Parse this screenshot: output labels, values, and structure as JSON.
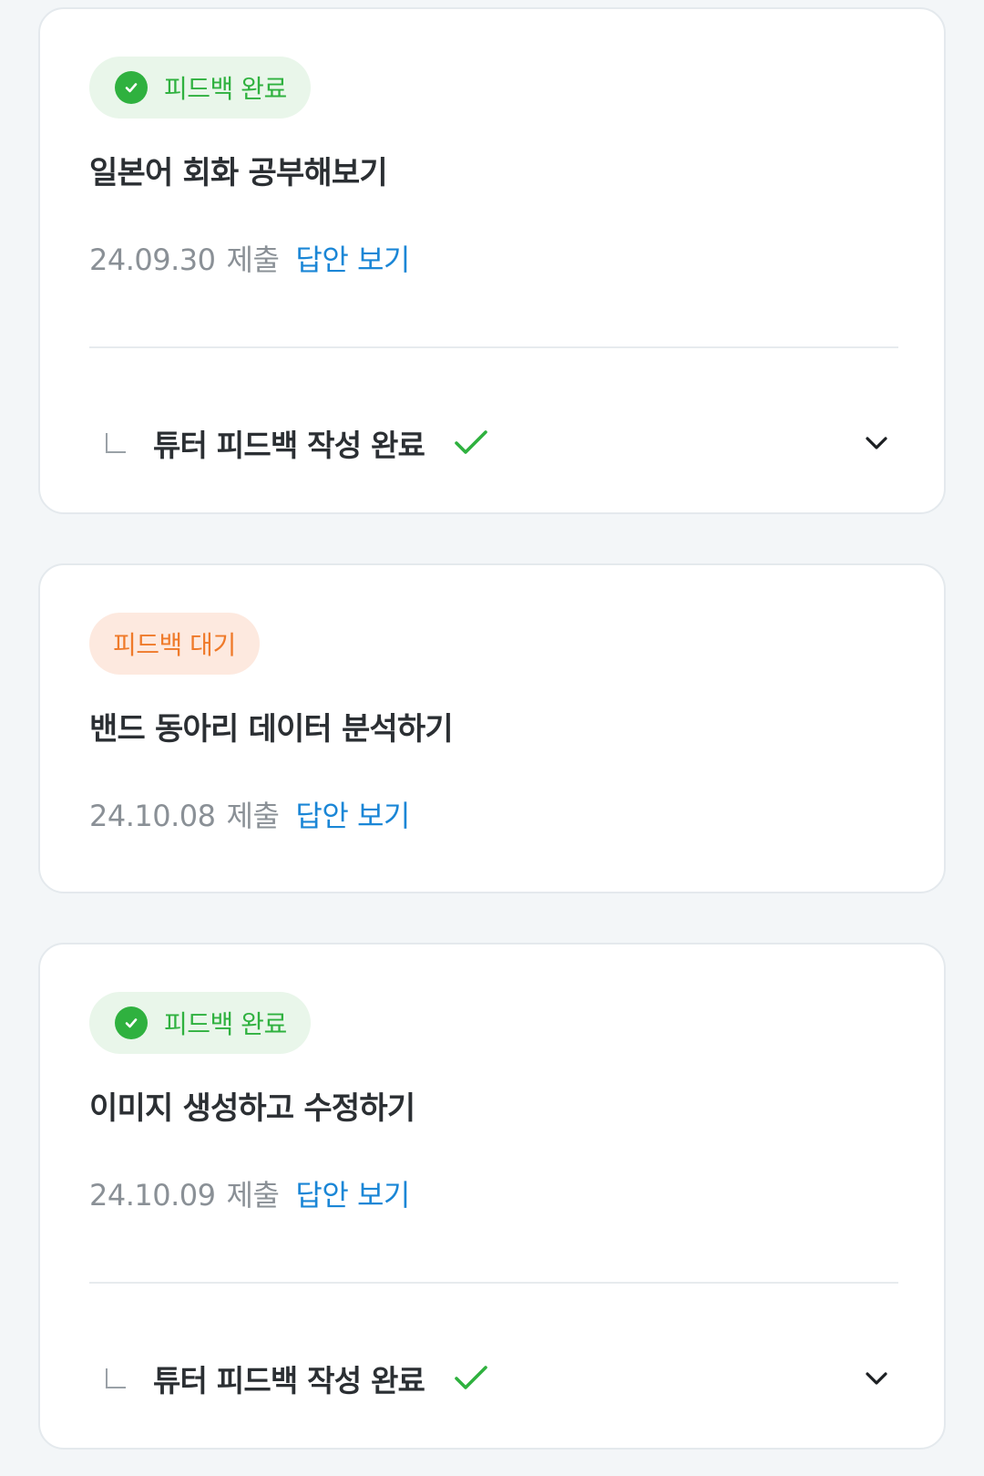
{
  "cards": [
    {
      "status": "피드백 완료",
      "title": "일본어 회화 공부해보기",
      "date": "24.09.30",
      "submit_label": "제출",
      "view_answer": "답안 보기",
      "feedback": "튜터 피드백 작성 완료"
    },
    {
      "status": "피드백 대기",
      "title": "밴드 동아리 데이터 분석하기",
      "date": "24.10.08",
      "submit_label": "제출",
      "view_answer": "답안 보기"
    },
    {
      "status": "피드백 완료",
      "title": "이미지 생성하고 수정하기",
      "date": "24.10.09",
      "submit_label": "제출",
      "view_answer": "답안 보기",
      "feedback": "튜터 피드백 작성 완료"
    }
  ],
  "colors": {
    "done_green": "#2fb13f",
    "done_bg": "#e9f6ea",
    "wait_orange": "#ef7a2a",
    "wait_bg": "#fde9df",
    "link_blue": "#1a86d6",
    "page_bg": "#f3f6f8"
  },
  "icons": {
    "status_done": "check-circle-icon",
    "feedback_done": "checkmark-icon",
    "expand": "chevron-down-icon",
    "reply": "reply-corner-icon"
  }
}
